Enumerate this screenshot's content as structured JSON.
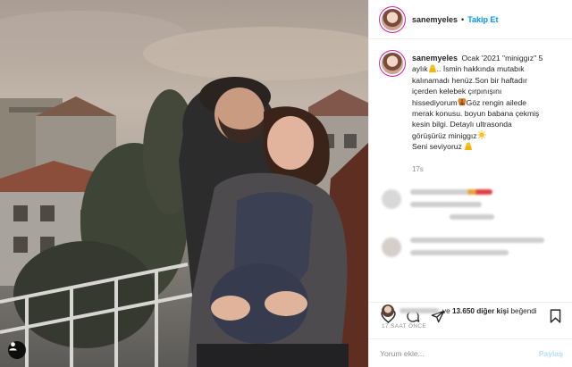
{
  "post": {
    "username": "sanemyeles",
    "follow_label": "Takip Et",
    "separator": "•",
    "caption_lines": [
      "Ocak '2021 \"miniggız\" 5",
      "aylık",
      ".. İsmin hakkında mutabık",
      "kalınamadı henüz.Son bir haftadır",
      "içerden kelebek çırpınışını",
      "hissediyorum",
      "Göz rengin ailede",
      "merak konusu. boyun babana çekmiş",
      "kesin bilgi. Detaylı ultrasonda",
      "görüşürüz miniggız",
      "Seni seviyoruz"
    ],
    "caption_time": "17s"
  },
  "likes": {
    "connector": "ve",
    "count_text": "13.650 diğer kişi",
    "suffix": "beğendi"
  },
  "timestamp": "17 SAAT ÖNCE",
  "comment_box": {
    "placeholder": "Yorum ekle...",
    "post_label": "Paylaş"
  },
  "icons": {
    "like": "heart-icon",
    "comment": "comment-bubble-icon",
    "share": "paper-plane-icon",
    "save": "bookmark-icon",
    "tag": "person-tag-icon"
  },
  "colors": {
    "link_blue": "#0095f6",
    "post_disabled": "#b2dffc",
    "muted": "#8e8e8e",
    "text": "#262626"
  }
}
